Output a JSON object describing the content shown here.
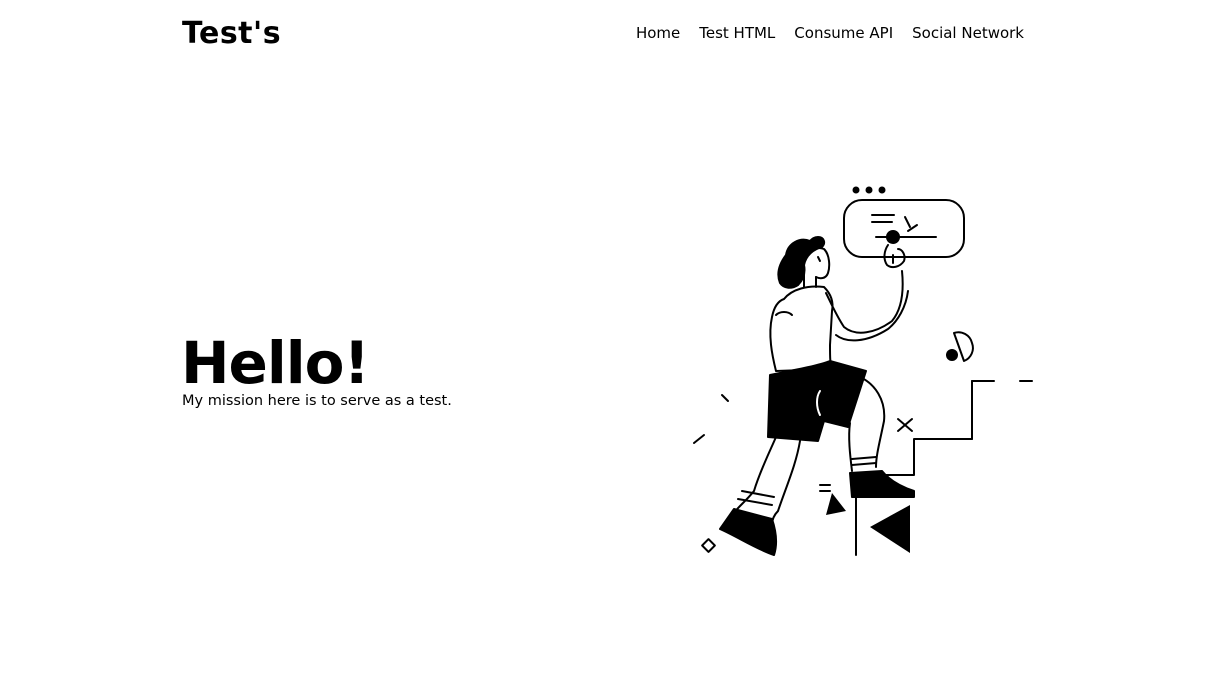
{
  "navbar": {
    "brand": "Test's",
    "links": [
      {
        "label": "Home"
      },
      {
        "label": "Test HTML"
      },
      {
        "label": "Consume API"
      },
      {
        "label": "Social Network"
      }
    ]
  },
  "hero": {
    "title": "Hello!",
    "subtitle": "My mission here is to serve as a test."
  },
  "illustration": {
    "icon": "person-climbing-stairs-illustration"
  }
}
